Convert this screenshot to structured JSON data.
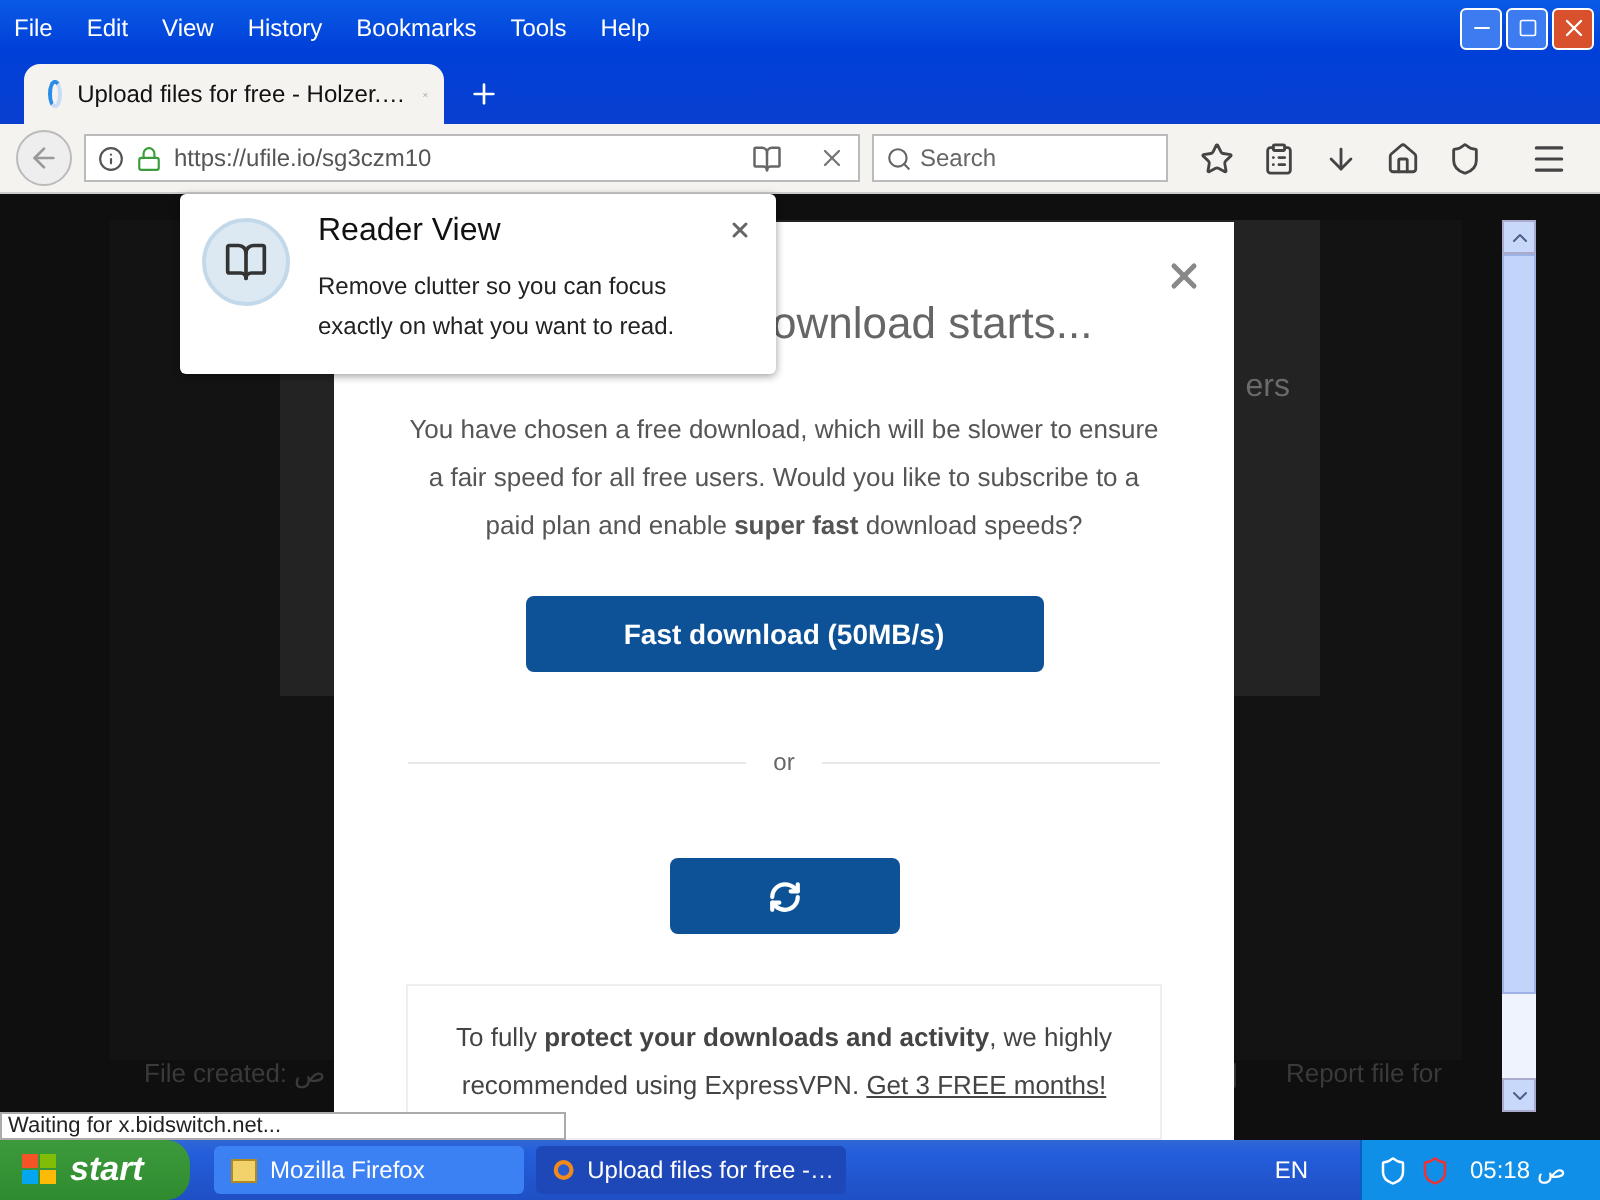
{
  "menu": [
    "File",
    "Edit",
    "View",
    "History",
    "Bookmarks",
    "Tools",
    "Help"
  ],
  "tabs": [
    {
      "title": "Upload files for free - Holzer.…",
      "selected": true,
      "loading": true
    }
  ],
  "address_bar": {
    "url": "https://ufile.io/sg3czm10"
  },
  "search": {
    "placeholder": "Search"
  },
  "background_page": {
    "side_text": "ers",
    "footer_left": "File created: ص",
    "footer_separator": "|",
    "footer_right": "Report file for"
  },
  "modal": {
    "heading": "ownload starts...",
    "message": "You have chosen a free download, which will be slower to ensure a fair speed for all free users. Would you like to subscribe to a paid plan and enable **super fast** download speeds?",
    "primary_button": "Fast download (50MB/s)",
    "divider": "or",
    "secondary_button_loading": true,
    "vpn_text": "To fully **protect your downloads and activity**, we highly recommended using ExpressVPN.",
    "vpn_link": "Get 3 FREE months!"
  },
  "reader_popup": {
    "title": "Reader View",
    "text": "Remove clutter so you can focus exactly on what you want to read."
  },
  "status_text": "Waiting for x.bidswitch.net...",
  "taskbar": {
    "start": "start",
    "tasks": [
      {
        "label": "Mozilla Firefox",
        "selected": false,
        "kind": "folder"
      },
      {
        "label": "Upload files for free -…",
        "selected": true,
        "kind": "browser"
      }
    ],
    "language": "EN",
    "clock": "05:18 ص"
  }
}
